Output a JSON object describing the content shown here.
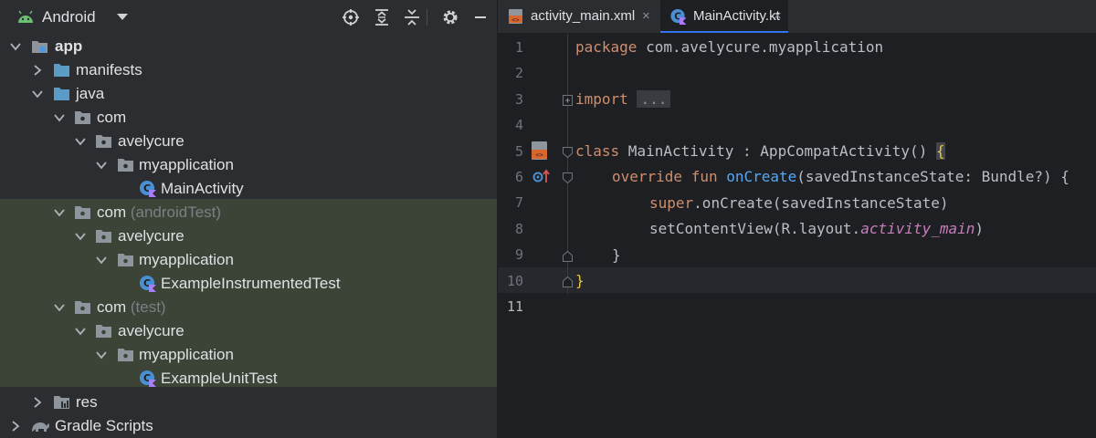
{
  "project_panel": {
    "view_label": "Android",
    "tree": [
      {
        "label": "app",
        "dim": ""
      },
      {
        "label": "manifests",
        "dim": ""
      },
      {
        "label": "java",
        "dim": ""
      },
      {
        "label": "com",
        "dim": ""
      },
      {
        "label": "avelycure",
        "dim": ""
      },
      {
        "label": "myapplication",
        "dim": ""
      },
      {
        "label": "MainActivity",
        "dim": ""
      },
      {
        "label": "com",
        "dim": "(androidTest)"
      },
      {
        "label": "avelycure",
        "dim": ""
      },
      {
        "label": "myapplication",
        "dim": ""
      },
      {
        "label": "ExampleInstrumentedTest",
        "dim": ""
      },
      {
        "label": "com",
        "dim": "(test)"
      },
      {
        "label": "avelycure",
        "dim": ""
      },
      {
        "label": "myapplication",
        "dim": ""
      },
      {
        "label": "ExampleUnitTest",
        "dim": ""
      },
      {
        "label": "res",
        "dim": ""
      },
      {
        "label": "Gradle Scripts",
        "dim": ""
      }
    ]
  },
  "editor": {
    "tabs": [
      {
        "label": "activity_main.xml",
        "close": "×"
      },
      {
        "label": "MainActivity.kt",
        "close": "×"
      }
    ],
    "line_numbers": [
      "1",
      "2",
      "3",
      "4",
      "5",
      "6",
      "7",
      "8",
      "9",
      "10",
      "11"
    ],
    "code": {
      "l1_kw": "package",
      "l1_rest": " com.avelycure.myapplication",
      "l3_kw": "import",
      "l3_dots": "...",
      "l6_kw": "class",
      "l6_rest": " MainActivity : AppCompatActivity() ",
      "l6_brace": "{",
      "l7_kw": "override fun",
      "l7_fn": "onCreate",
      "l7_rest": "(savedInstanceState: Bundle?) {",
      "l8_kw": "super",
      "l8_rest": ".onCreate(savedInstanceState)",
      "l9_pre": "setContentView(R.layout.",
      "l9_it": "activity_main",
      "l9_post": ")",
      "l10": "}",
      "l11": "}"
    }
  },
  "colors": {
    "panel_bg": "#2b2d30",
    "editor_bg": "#1e1f22",
    "test_band": "#3c4437",
    "keyword": "#cf8e6d",
    "function": "#56a8f5",
    "italic_member": "#c77dbb",
    "accent": "#3574f0"
  },
  "icons": [
    "android-icon",
    "locate-icon",
    "expand-all-icon",
    "collapse-all-icon",
    "gear-icon",
    "minimize-icon",
    "folder-icon",
    "package-icon",
    "kotlin-class-icon",
    "res-folder-icon",
    "gradle-icon",
    "xml-file-icon",
    "kotlin-file-icon",
    "layout-file-gutter-icon",
    "override-gutter-icon",
    "fold-icon"
  ]
}
